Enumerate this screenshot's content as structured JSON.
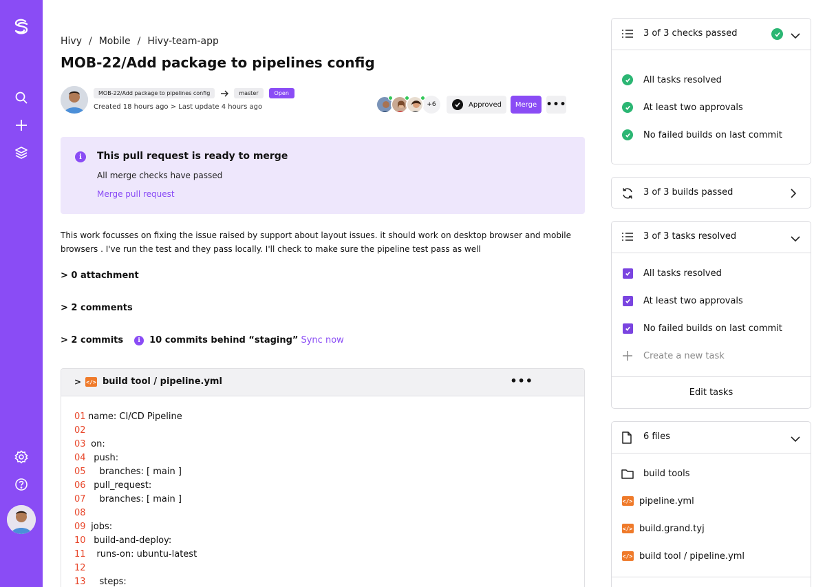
{
  "breadcrumb": {
    "items": [
      "Hivy",
      "Mobile",
      "Hivy-team-app"
    ],
    "separator": "/"
  },
  "page_title": "MOB-22/Add package to pipelines config",
  "pr": {
    "source_branch": "MOB-22/Add package to pipelines config",
    "target_branch": "master",
    "status": "Open",
    "meta": "Created 18 hours ago > Last update 4 hours ago",
    "reviewers_more": "+6",
    "approved_label": "Approved",
    "merge_label": "Merge",
    "more_label": "•••"
  },
  "notice": {
    "title": "This pull request is ready to merge",
    "subtitle": "All merge checks have passed",
    "link": "Merge pull request"
  },
  "description": "This work focusses on fixing the issue raised by support about layout issues. it should work on desktop browser and mobile browsers . I've run the test and they pass locally. I'll check to make sure the pipeline test pass as well",
  "sections": {
    "attachments": "> 0 attachment",
    "comments": "> 2 comments",
    "commits": "> 2 commits",
    "commits_behind": "10 commits behind “staging”",
    "sync": "Sync now"
  },
  "code": {
    "chevron": ">",
    "file_name": "build tool / pipeline.yml",
    "lines": [
      {
        "n": "01",
        "t": "name: CI/CD Pipeline"
      },
      {
        "n": "02",
        "t": ""
      },
      {
        "n": "03",
        "t": " on:"
      },
      {
        "n": "04",
        "t": "  push:"
      },
      {
        "n": "05",
        "t": "    branches: [ main ]"
      },
      {
        "n": "06",
        "t": "  pull_request:"
      },
      {
        "n": "07",
        "t": "    branches: [ main ]"
      },
      {
        "n": "08",
        "t": ""
      },
      {
        "n": "09",
        "t": " jobs:"
      },
      {
        "n": "10",
        "t": "  build-and-deploy:"
      },
      {
        "n": "11",
        "t": "   runs-on: ubuntu-latest"
      },
      {
        "n": "12",
        "t": ""
      },
      {
        "n": "13",
        "t": "    steps:"
      }
    ]
  },
  "checks_card": {
    "title": "3 of 3 checks passed",
    "items": [
      "All tasks resolved",
      "At least two approvals",
      "No failed builds on last commit"
    ]
  },
  "builds_card": {
    "title": "3 of 3 builds passed"
  },
  "tasks_card": {
    "title": "3 of 3 tasks resolved",
    "items": [
      "All tasks resolved",
      "At least two approvals",
      "No failed builds on last commit"
    ],
    "new_task": "Create a new task",
    "edit_label": "Edit tasks"
  },
  "files_card": {
    "title": "6 files",
    "folder": "build tools",
    "files": [
      "pipeline.yml",
      "build.grand.tyj",
      "build tool / pipeline.yml"
    ]
  },
  "colors": {
    "accent": "#8a4cf5",
    "success": "#2bb673",
    "line_number": "#e8472b",
    "file_icon": "#ef7a2a"
  }
}
